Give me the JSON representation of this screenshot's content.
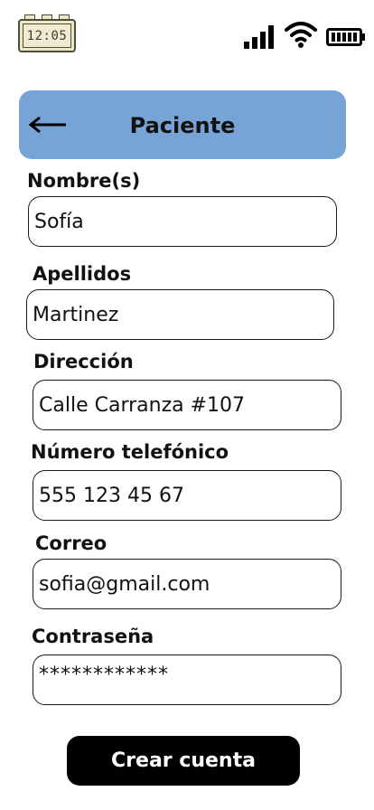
{
  "status_bar": {
    "time": "12:05",
    "icons": [
      "clock-widget-icon",
      "signal-icon",
      "wifi-icon",
      "battery-icon"
    ]
  },
  "header": {
    "back_icon": "left-arrow-icon",
    "title": "Paciente",
    "background_color": "#76a4d6"
  },
  "form": {
    "fields": [
      {
        "label": "Nombre(s)",
        "value": "Sofía",
        "type": "text"
      },
      {
        "label": "Apellidos",
        "value": "Martinez",
        "type": "text"
      },
      {
        "label": "Dirección",
        "value": "Calle Carranza #107",
        "type": "text"
      },
      {
        "label": "Número telefónico",
        "value": "555 123 45 67",
        "type": "tel"
      },
      {
        "label": "Correo",
        "value": "sofia@gmail.com",
        "type": "email"
      },
      {
        "label": "Contraseña",
        "value": "************",
        "type": "password"
      }
    ]
  },
  "actions": {
    "submit_label": "Crear cuenta",
    "submit_color": "#000000"
  }
}
